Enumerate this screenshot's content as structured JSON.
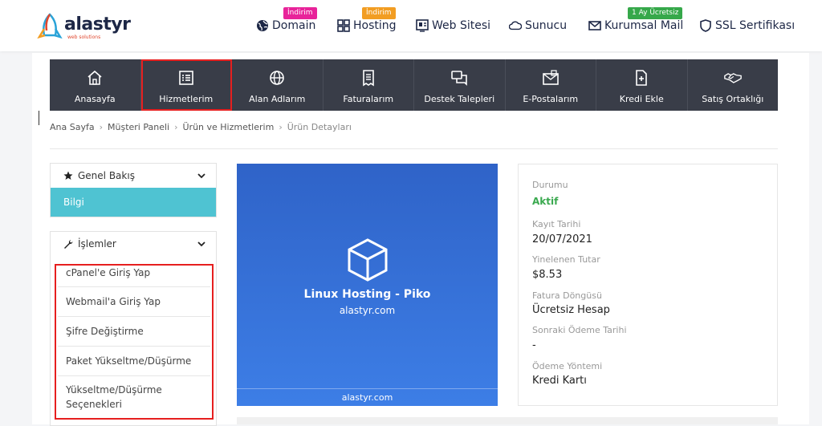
{
  "brand": {
    "name": "alastyr",
    "tagline": "web solutions"
  },
  "topnav": [
    {
      "label": "Domain",
      "icon": "globe-icon",
      "badge": "İndirim",
      "badge_color": "#e8239a"
    },
    {
      "label": "Hosting",
      "icon": "apps-icon",
      "badge": "İndirim",
      "badge_color": "#f29d22"
    },
    {
      "label": "Web Sitesi",
      "icon": "website-icon"
    },
    {
      "label": "Sunucu",
      "icon": "cloud-icon"
    },
    {
      "label": "Kurumsal Mail",
      "icon": "mail-icon",
      "badge": "1 Ay Ücretsiz",
      "badge_color": "#36a84a"
    },
    {
      "label": "SSL Sertifikası",
      "icon": "shield-icon"
    }
  ],
  "mainnav": [
    {
      "label": "Anasayfa",
      "icon": "home-icon"
    },
    {
      "label": "Hizmetlerim",
      "icon": "list-icon",
      "active": true
    },
    {
      "label": "Alan Adlarım",
      "icon": "globe-icon"
    },
    {
      "label": "Faturalarım",
      "icon": "invoice-icon"
    },
    {
      "label": "Destek Talepleri",
      "icon": "chat-icon"
    },
    {
      "label": "E-Postalarım",
      "icon": "email-icon"
    },
    {
      "label": "Kredi Ekle",
      "icon": "add-file-icon"
    },
    {
      "label": "Satış Ortaklığı",
      "icon": "handshake-icon"
    }
  ],
  "breadcrumb": [
    "Ana Sayfa",
    "Müşteri Paneli",
    "Ürün ve Hizmetlerim",
    "Ürün Detayları"
  ],
  "sidebar": {
    "overview": {
      "title": "Genel Bakış",
      "active_item": "Bilgi"
    },
    "operations": {
      "title": "İşlemler",
      "items": [
        "cPanel'e Giriş Yap",
        "Webmail'a Giriş Yap",
        "Şifre Değiştirme",
        "Paket Yükseltme/Düşürme",
        "Yükseltme/Düşürme Seçenekleri"
      ]
    }
  },
  "product": {
    "name": "Linux Hosting - Piko",
    "domain": "alastyr.com",
    "footer": "alastyr.com"
  },
  "details": [
    {
      "label": "Durumu",
      "value": "Aktif"
    },
    {
      "label": "Kayıt Tarihi",
      "value": "20/07/2021"
    },
    {
      "label": "Yinelenen Tutar",
      "value": "$8.53"
    },
    {
      "label": "Fatura Döngüsü",
      "value": "Ücretsiz Hesap"
    },
    {
      "label": "Sonraki Ödeme Tarihi",
      "value": "-"
    },
    {
      "label": "Ödeme Yöntemi",
      "value": "Kredi Kartı"
    }
  ]
}
